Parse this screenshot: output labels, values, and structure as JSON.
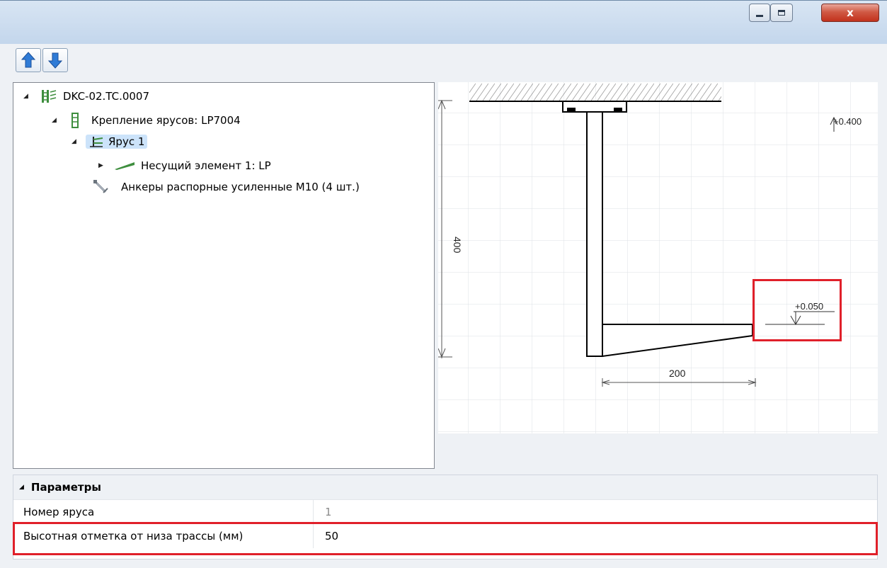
{
  "window": {
    "close_symbol": "x",
    "controls": [
      "minimize-icon",
      "maximize-icon",
      "close-icon"
    ]
  },
  "toolbar": {
    "icons": [
      "arrow-up-icon",
      "arrow-down-icon"
    ]
  },
  "tree": {
    "items": [
      {
        "label": "DKC-02.TC.0007",
        "icon": "rack-icon",
        "expanded": true
      },
      {
        "label": "Крепление ярусов: LP7004",
        "icon": "post-icon",
        "expanded": true
      },
      {
        "label": "Ярус 1",
        "icon": "tier-icon",
        "expanded": true,
        "selected": true
      },
      {
        "label": "Несущий элемент 1: LP",
        "icon": "bracket-icon",
        "expanded": false
      },
      {
        "label": "Анкеры распорные усиленные М10 (4 шт.)",
        "icon": "anchor-icon"
      }
    ]
  },
  "drawing": {
    "dim_vertical": "400",
    "dim_horizontal": "200",
    "level_top": "+0.400",
    "level_tier": "+0.050"
  },
  "properties": {
    "section_title": "Параметры",
    "rows": [
      {
        "label": "Номер яруса",
        "value": "1",
        "readonly": true
      },
      {
        "label": "Высотная отметка от низа трассы (мм)",
        "value": "50",
        "readonly": false,
        "highlighted": true
      }
    ]
  },
  "colors": {
    "highlight": "#e0202a",
    "selection": "#cce3fa",
    "titlebar": "#c3d6ec"
  }
}
